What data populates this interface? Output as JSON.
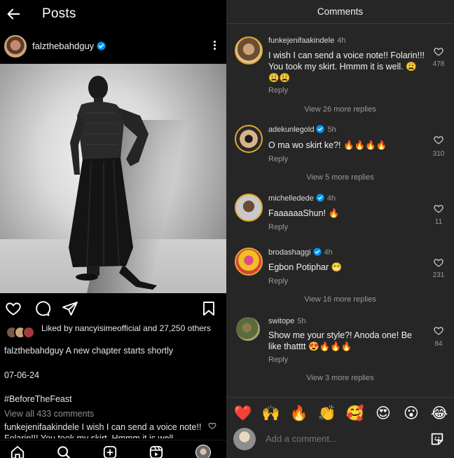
{
  "left": {
    "title": "Posts",
    "author": "falzthebahdguy",
    "liked_by": "Liked by nancyisimeofficial and 27,250 others",
    "caption_user": "falzthebahdguy",
    "caption_text": " A new chapter starts shortly",
    "date": "07-06-24",
    "hashtag": "#BeforeTheFeast",
    "view_all": "View all 433 comments",
    "first_comment": "funkejenifaakindele I wish I can send a voice note!! Folarin!!! You took my skirt. Hmmm it is well."
  },
  "right": {
    "title": "Comments",
    "comments": [
      {
        "user": "funkejenifaakindele",
        "time": "4h",
        "verified": false,
        "text": "I wish I can send a voice note!! Folarin!!! You took my skirt. Hmmm it is well. 😩😩😩",
        "reply": "Reply",
        "likes": "478",
        "more": "View 26 more replies"
      },
      {
        "user": "adekunlegold",
        "time": "5h",
        "verified": true,
        "text": "O ma wo skirt ke?! 🔥🔥🔥🔥",
        "reply": "Reply",
        "likes": "310",
        "more": "View 5 more replies"
      },
      {
        "user": "michelledede",
        "time": "4h",
        "verified": true,
        "text": "FaaaaaaShun! 🔥",
        "reply": "Reply",
        "likes": "11",
        "more": ""
      },
      {
        "user": "brodashaggi",
        "time": "4h",
        "verified": true,
        "text": "Egbon Potiphar 😁",
        "reply": "Reply",
        "likes": "231",
        "more": "View 16 more replies"
      },
      {
        "user": "switope",
        "time": "5h",
        "verified": false,
        "text": "Show me your style?! Anoda one! Be like thatttt 😍🔥🔥🔥",
        "reply": "Reply",
        "likes": "84",
        "more": "View 3 more replies"
      }
    ],
    "emojis": [
      "❤️",
      "🙌",
      "🔥",
      "👏",
      "🥰",
      "😍",
      "😮",
      "😂"
    ],
    "add_placeholder": "Add a comment..."
  },
  "colors": {
    "left_bg": "#000000",
    "right_bg": "#262626",
    "verified": "#0095f6",
    "muted": "#9a9a9a"
  },
  "icons": [
    "back-arrow-icon",
    "kebab-menu-icon",
    "heart-icon",
    "comment-icon",
    "share-icon",
    "bookmark-icon",
    "home-icon",
    "search-icon",
    "create-icon",
    "reels-icon",
    "sticker-icon"
  ]
}
